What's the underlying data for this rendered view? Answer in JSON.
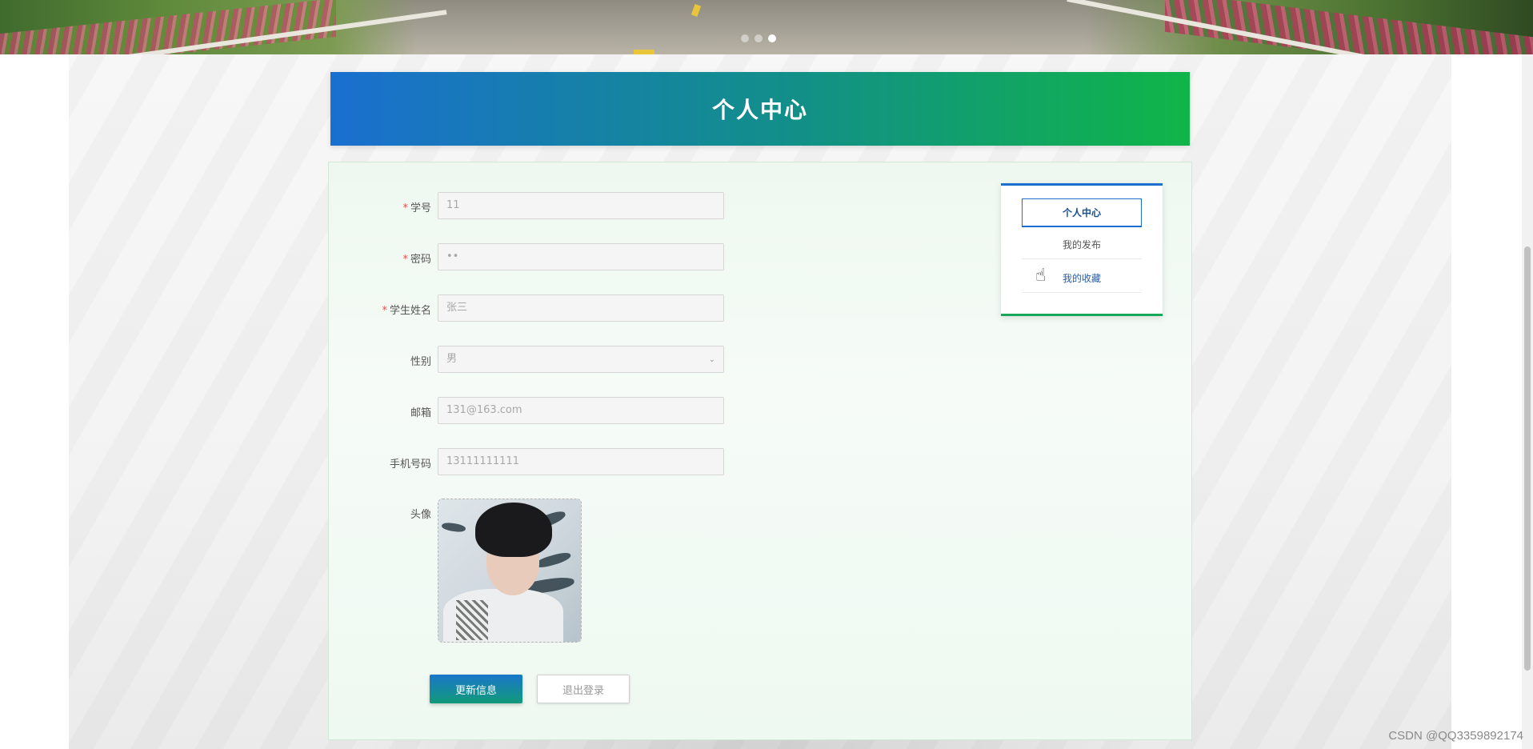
{
  "banner": {
    "active_dot": 3,
    "dot_count": 3
  },
  "header": {
    "title": "个人中心"
  },
  "form": {
    "fields": [
      {
        "label": "学号",
        "required": true,
        "value": "11"
      },
      {
        "label": "密码",
        "required": true,
        "value": "••"
      },
      {
        "label": "学生姓名",
        "required": true,
        "value": "张三"
      },
      {
        "label": "性别",
        "required": false,
        "value": "男",
        "type": "select"
      },
      {
        "label": "邮箱",
        "required": false,
        "value": "131@163.com"
      },
      {
        "label": "手机号码",
        "required": false,
        "value": "13111111111"
      }
    ],
    "avatar_label": "头像",
    "required_mark": "*",
    "update_button": "更新信息",
    "logout_button": "退出登录"
  },
  "side_menu": {
    "items": [
      {
        "label": "个人中心",
        "active": true
      },
      {
        "label": "我的发布",
        "active": false
      },
      {
        "label": "我的收藏",
        "active": false
      }
    ]
  },
  "colors": {
    "header_start": "#1a6fcf",
    "header_end": "#10b548",
    "required": "#e34d4d"
  },
  "icons": {
    "select_arrow": "chevron-down-icon",
    "cursor": "hand-pointer-icon"
  },
  "watermark": "CSDN @QQ3359892174"
}
